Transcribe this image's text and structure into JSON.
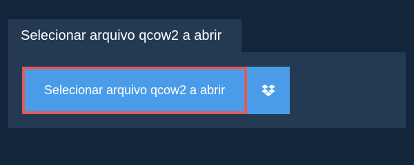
{
  "tab": {
    "label": "Selecionar arquivo qcow2 a abrir"
  },
  "upload": {
    "button_label": "Selecionar arquivo qcow2 a abrir",
    "dropbox_icon": "dropbox-icon"
  },
  "colors": {
    "page_background": "#13253b",
    "panel_background": "#233a52",
    "button_background": "#4b9ce8",
    "highlight_border": "#e05a5a",
    "text": "#ffffff"
  }
}
